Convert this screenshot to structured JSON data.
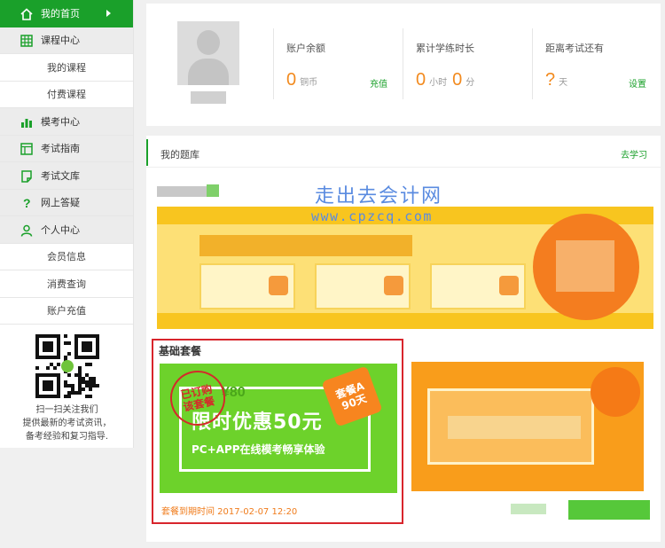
{
  "sidebar": {
    "home": "我的首页",
    "course_center": "课程中心",
    "my_courses": "我的课程",
    "paid_courses": "付费课程",
    "mock_center": "模考中心",
    "exam_guide": "考试指南",
    "exam_library": "考试文库",
    "online_qa": "网上答疑",
    "personal_center": "个人中心",
    "member_info": "会员信息",
    "consumption_query": "消费查询",
    "account_recharge": "账户充值",
    "qr_text": [
      "扫一扫关注我们",
      "提供最新的考试资讯，",
      "备考经验和复习指导."
    ]
  },
  "stats": {
    "balance_title": "账户余额",
    "balance_value": "0",
    "balance_unit": "铜币",
    "recharge_link": "充值",
    "study_title": "累计学练时长",
    "study_hours": "0",
    "study_hours_unit": "小时",
    "study_minutes": "0",
    "study_minutes_unit": "分",
    "exam_title": "距离考试还有",
    "exam_value": "?",
    "exam_unit": "天",
    "settings_link": "设置"
  },
  "bank": {
    "title": "我的题库",
    "go_study": "去学习",
    "watermark_cn": "走出去会计网",
    "watermark_url": "www.cpzcq.com",
    "package_title": "基础套餐",
    "stamp_line1": "已订购",
    "stamp_line2": "该套餐",
    "old_price": "¥80",
    "promo_main": "限时优惠50元",
    "promo_sub": "PC+APP在线模考畅享体验",
    "badge_line1": "套餐A",
    "badge_line2": "90天",
    "expire_text": "套餐到期时间 2017-02-07 12:20"
  },
  "colors": {
    "accent_green": "#1aa02a",
    "number_orange": "#f28a1e",
    "selection_red": "#d8252c"
  }
}
